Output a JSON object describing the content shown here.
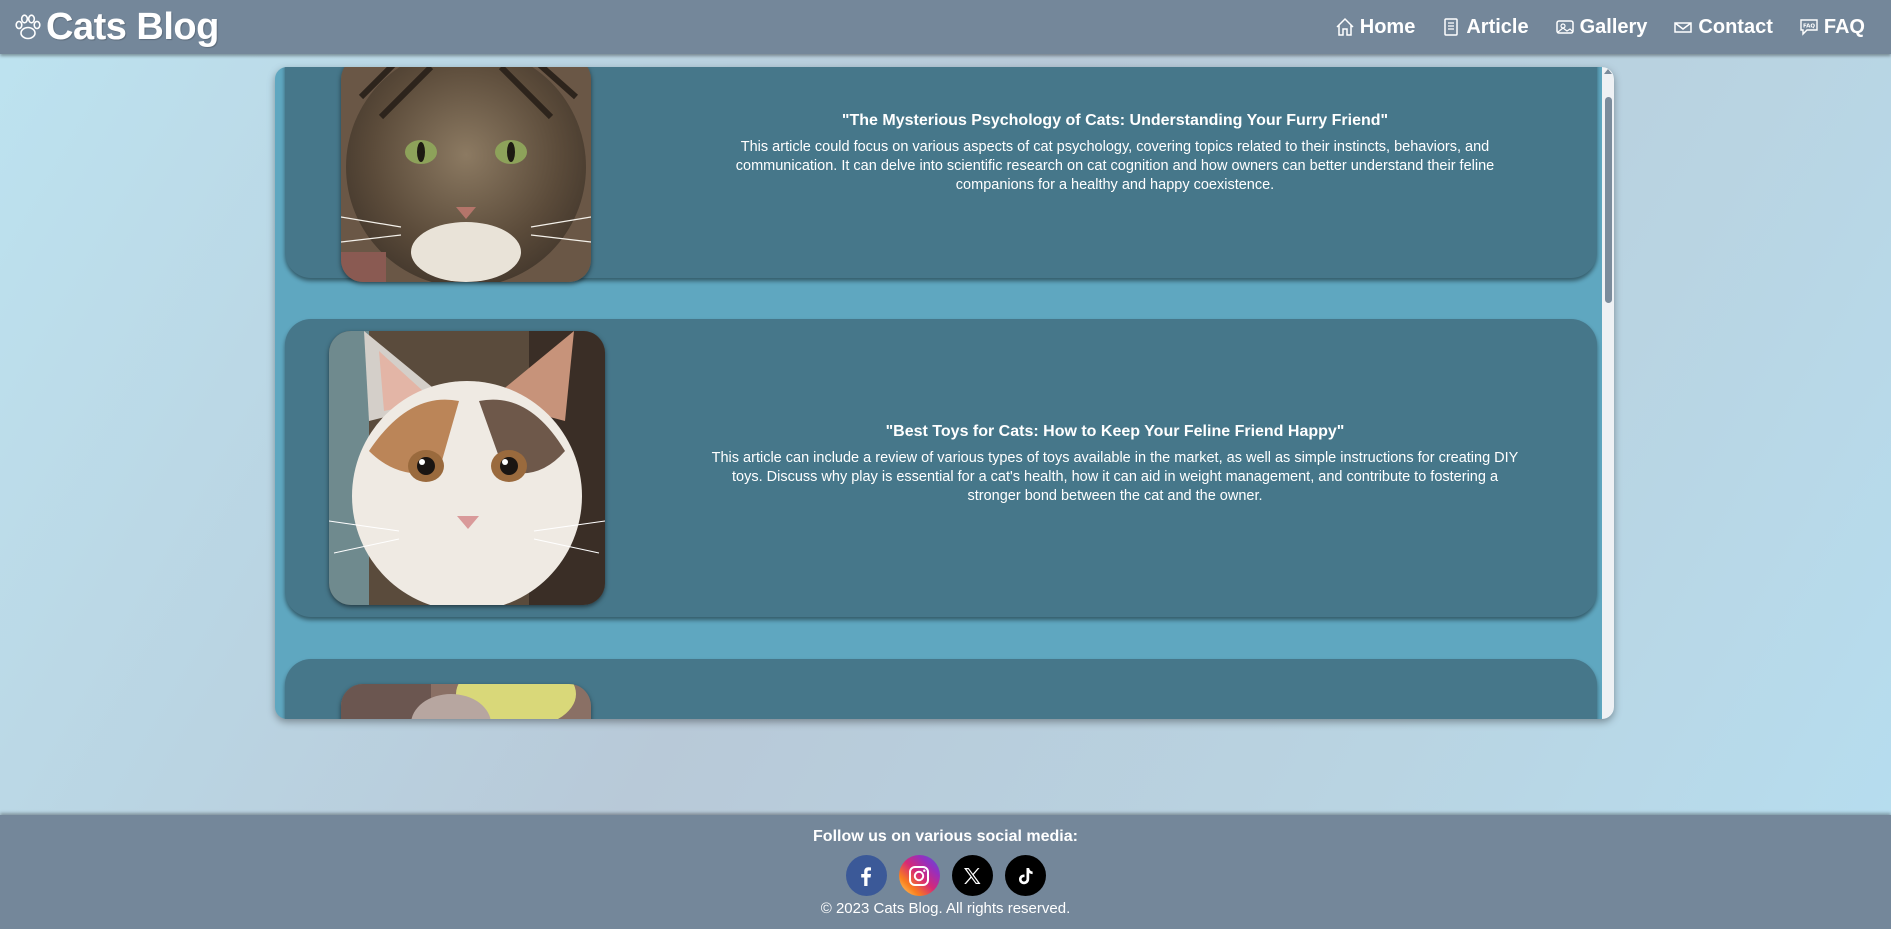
{
  "header": {
    "brand": "Cats Blog",
    "nav": [
      {
        "label": "Home",
        "icon": "home-icon"
      },
      {
        "label": "Article",
        "icon": "article-icon"
      },
      {
        "label": "Gallery",
        "icon": "gallery-icon"
      },
      {
        "label": "Contact",
        "icon": "contact-icon"
      },
      {
        "label": "FAQ",
        "icon": "faq-icon"
      }
    ]
  },
  "articles": [
    {
      "title": "\"The Mysterious Psychology of Cats: Understanding Your Furry Friend\"",
      "body": "This article could focus on various aspects of cat psychology, covering topics related to their instincts, behaviors, and communication. It can delve into scientific research on cat cognition and how owners can better understand their feline companions for a healthy and happy coexistence.",
      "image": "tabby-cat-photo"
    },
    {
      "title": "\"Best Toys for Cats: How to Keep Your Feline Friend Happy\"",
      "body": "This article can include a review of various types of toys available in the market, as well as simple instructions for creating DIY toys. Discuss why play is essential for a cat's health, how it can aid in weight management, and contribute to fostering a stronger bond between the cat and the owner.",
      "image": "calico-kitten-photo"
    },
    {
      "title": "",
      "body": "",
      "image": "cat-with-toy-photo"
    }
  ],
  "footer": {
    "follow": "Follow us on various social media:",
    "socials": [
      {
        "name": "facebook-icon",
        "color": "#3b5998"
      },
      {
        "name": "instagram-icon",
        "color": "#d62976"
      },
      {
        "name": "x-icon",
        "color": "#000000"
      },
      {
        "name": "tiktok-icon",
        "color": "#000000"
      }
    ],
    "copyright": "© 2023 Cats Blog. All rights reserved."
  },
  "colors": {
    "header": "#74879a",
    "panel": "#5fa7c0",
    "card": "#46778a"
  }
}
